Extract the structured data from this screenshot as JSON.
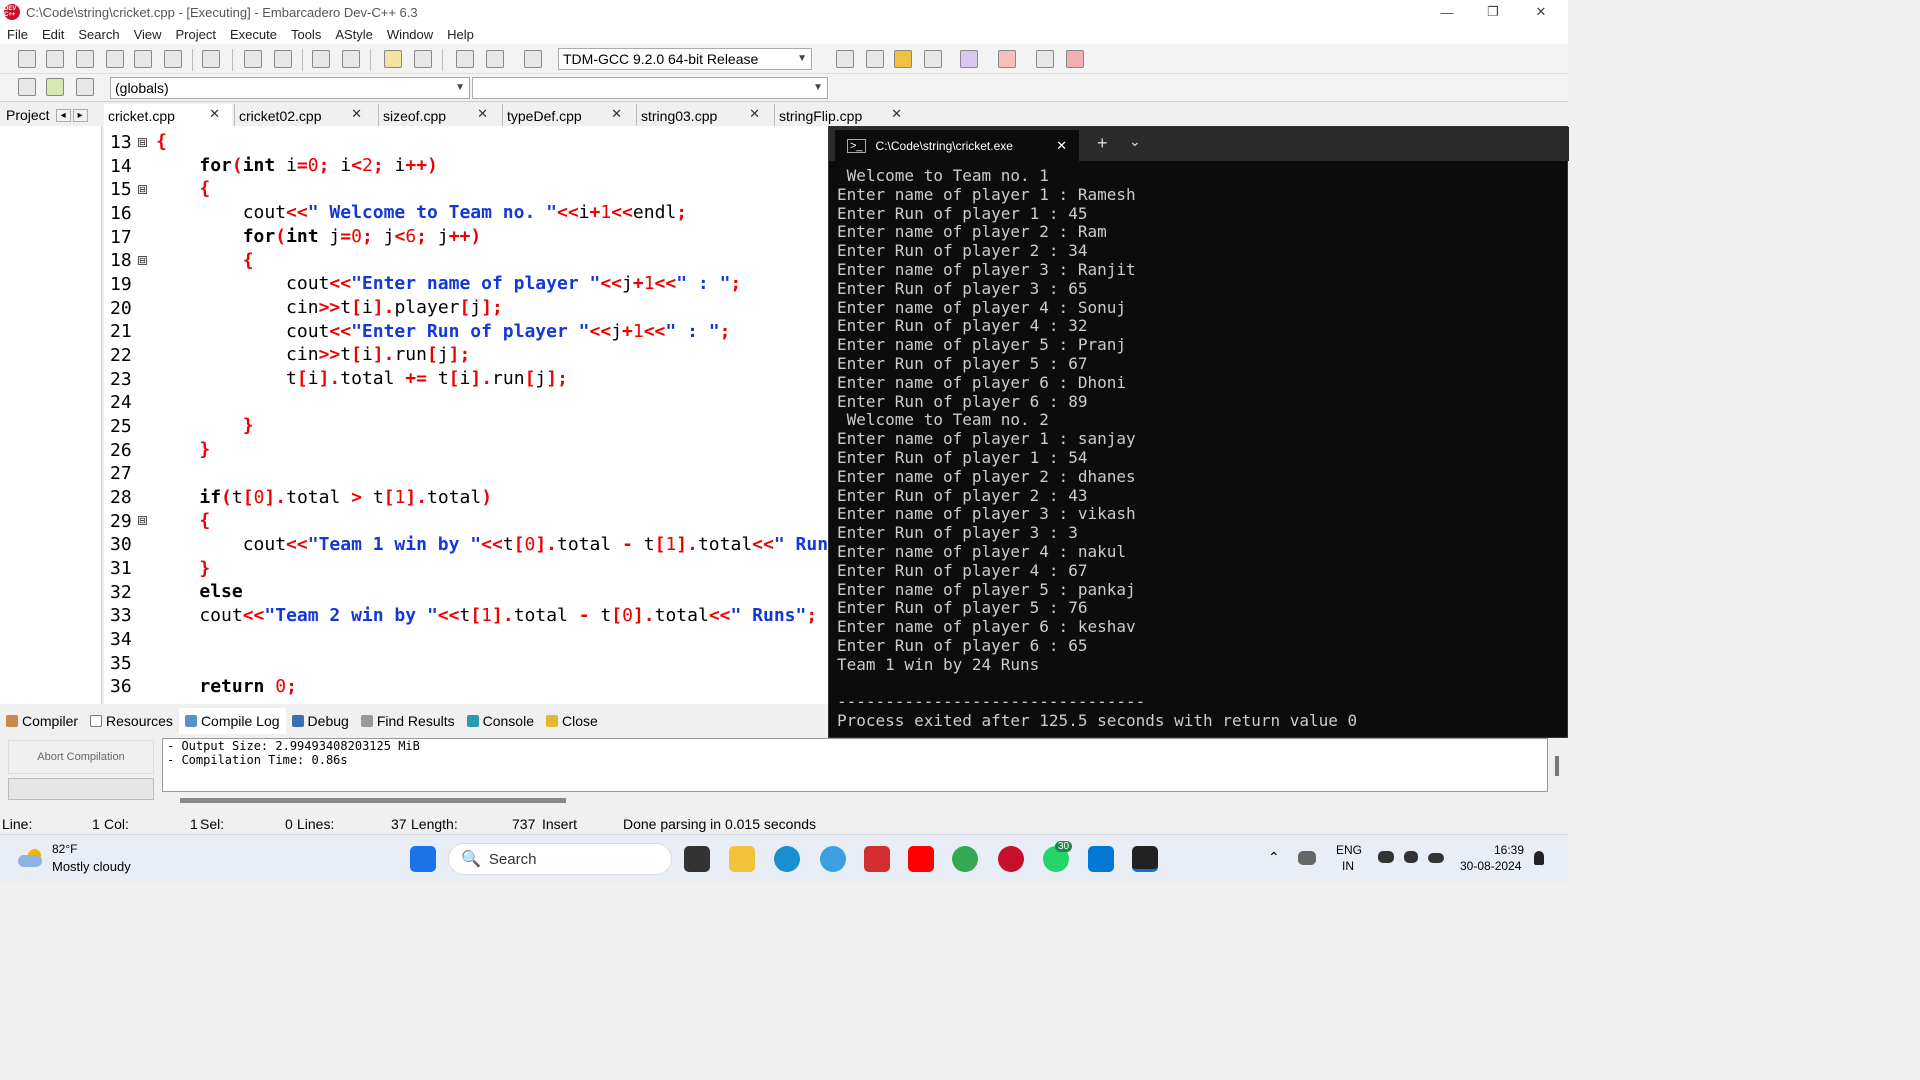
{
  "window": {
    "title": "C:\\Code\\string\\cricket.cpp - [Executing] - Embarcadero Dev-C++ 6.3",
    "app_icon_text": "DEV C++",
    "minimize": "—",
    "restore": "❐",
    "close": "✕"
  },
  "menu": [
    "File",
    "Edit",
    "Search",
    "View",
    "Project",
    "Execute",
    "Tools",
    "AStyle",
    "Window",
    "Help"
  ],
  "toolbar": {
    "compiler_select": "TDM-GCC 9.2.0 64-bit Release",
    "scope_select": "(globals)"
  },
  "project_panel": {
    "label": "Project",
    "prev": "◂",
    "next": "▸"
  },
  "tabs": [
    {
      "label": "cricket.cpp",
      "close": "✕"
    },
    {
      "label": "cricket02.cpp",
      "close": "✕"
    },
    {
      "label": "sizeof.cpp",
      "close": "✕"
    },
    {
      "label": "typeDef.cpp",
      "close": "✕"
    },
    {
      "label": "string03.cpp",
      "close": "✕"
    },
    {
      "label": "stringFlip.cpp",
      "close": "✕"
    }
  ],
  "editor": {
    "line_numbers": [
      "13",
      "14",
      "15",
      "16",
      "17",
      "18",
      "19",
      "20",
      "21",
      "22",
      "23",
      "24",
      "25",
      "26",
      "27",
      "28",
      "29",
      "30",
      "31",
      "32",
      "33",
      "34",
      "35",
      "36"
    ],
    "fold_markers": [
      "⊟",
      "⊟",
      "⊟",
      "⊟"
    ]
  },
  "console": {
    "tab_title": "C:\\Code\\string\\cricket.exe",
    "tab_close": "✕",
    "new_tab": "+",
    "dropdown": "⌄",
    "lines": [
      " Welcome to Team no. 1",
      "Enter name of player 1 : Ramesh",
      "Enter Run of player 1 : 45",
      "Enter name of player 2 : Ram",
      "Enter Run of player 2 : 34",
      "Enter name of player 3 : Ranjit",
      "Enter Run of player 3 : 65",
      "Enter name of player 4 : Sonuj",
      "Enter Run of player 4 : 32",
      "Enter name of player 5 : Pranj",
      "Enter Run of player 5 : 67",
      "Enter name of player 6 : Dhoni",
      "Enter Run of player 6 : 89",
      " Welcome to Team no. 2",
      "Enter name of player 1 : sanjay",
      "Enter Run of player 1 : 54",
      "Enter name of player 2 : dhanes",
      "Enter Run of player 2 : 43",
      "Enter name of player 3 : vikash",
      "Enter Run of player 3 : 3",
      "Enter name of player 4 : nakul",
      "Enter Run of player 4 : 67",
      "Enter name of player 5 : pankaj",
      "Enter Run of player 5 : 76",
      "Enter name of player 6 : keshav",
      "Enter Run of player 6 : 65",
      "Team 1 win by 24 Runs",
      "",
      "--------------------------------",
      "Process exited after 125.5 seconds with return value 0"
    ]
  },
  "bottom_tabs": [
    "Compiler",
    "Resources",
    "Compile Log",
    "Debug",
    "Find Results",
    "Console",
    "Close"
  ],
  "abort_button": "Abort Compilation",
  "compile_log": "- Output Size: 2.99493408203125 MiB\n- Compilation Time: 0.86s",
  "status": {
    "line_label": "Line:",
    "line_val": "1",
    "col_label": "Col:",
    "col_val": "1",
    "sel_label": "Sel:",
    "sel_val": "0",
    "lines_label": "Lines:",
    "lines_val": "37",
    "length_label": "Length:",
    "length_val": "737",
    "mode": "Insert",
    "message": "Done parsing in 0.015 seconds"
  },
  "taskbar": {
    "temp": "82°F",
    "weather": "Mostly cloudy",
    "search": "Search",
    "whatsapp_badge": "30",
    "lang1": "ENG",
    "lang2": "IN",
    "time": "16:39",
    "date": "30-08-2024",
    "chevron": "⌃"
  },
  "colors": {
    "keyword": "#000000",
    "string": "#1338d8",
    "punct": "#ee0000",
    "console_bg": "#0c0c0c"
  }
}
